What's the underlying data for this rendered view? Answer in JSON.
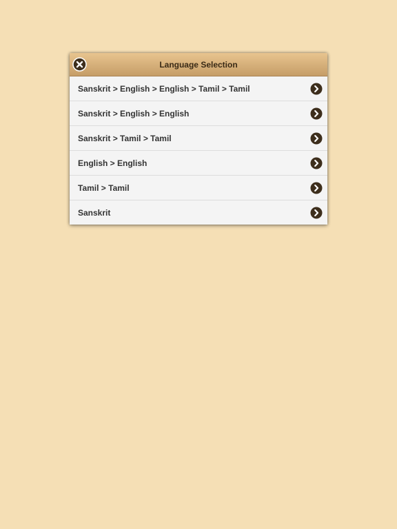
{
  "dialog": {
    "title": "Language Selection",
    "close_icon": "close-circle-icon",
    "items": [
      {
        "label": "Sanskrit > English > English > Tamil > Tamil",
        "icon": "chevron-right-circle-icon"
      },
      {
        "label": "Sanskrit > English > English",
        "icon": "chevron-right-circle-icon"
      },
      {
        "label": "Sanskrit > Tamil > Tamil",
        "icon": "chevron-right-circle-icon"
      },
      {
        "label": "English > English",
        "icon": "chevron-right-circle-icon"
      },
      {
        "label": "Tamil > Tamil",
        "icon": "chevron-right-circle-icon"
      },
      {
        "label": "Sanskrit",
        "icon": "chevron-right-circle-icon"
      }
    ]
  },
  "colors": {
    "background": "#f5dfb5",
    "header_top": "#e8c48f",
    "header_bottom": "#c59d67",
    "icon_dark": "#3d2e1c"
  }
}
